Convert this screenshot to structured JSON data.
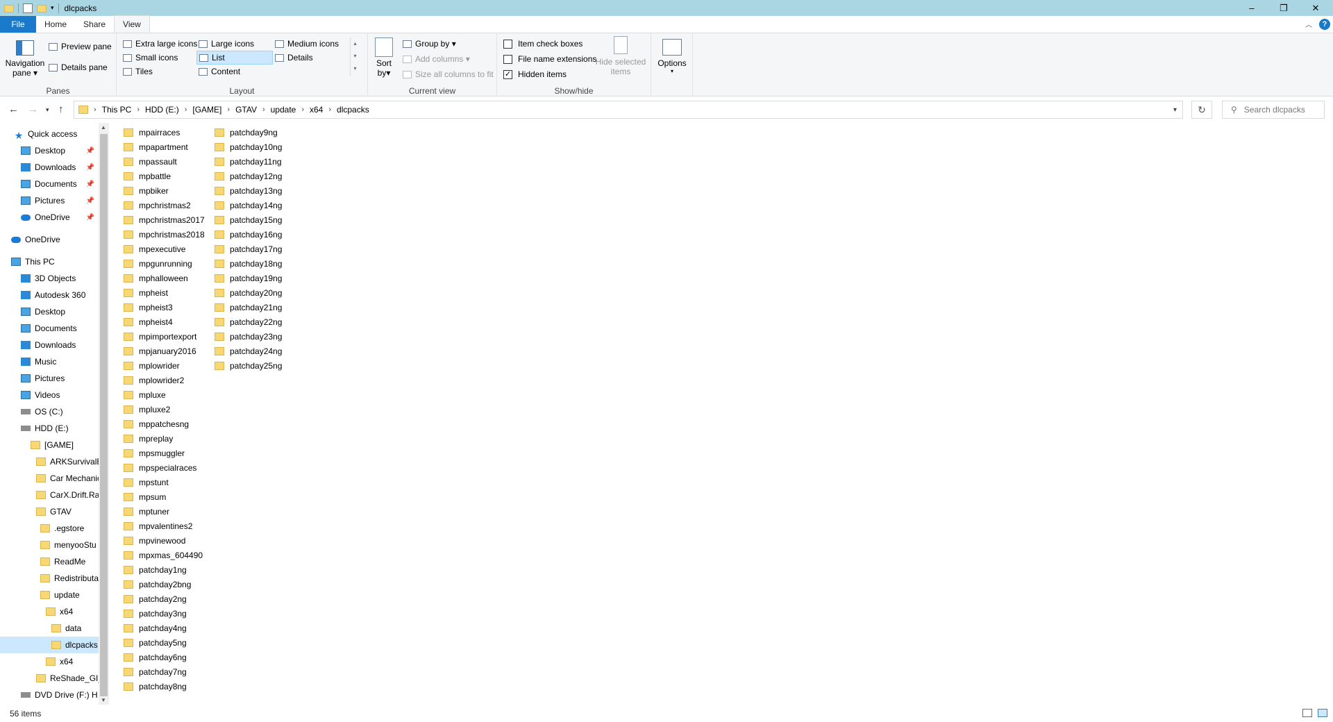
{
  "window": {
    "title": "dlcpacks",
    "minimize": "–",
    "maximize": "❐",
    "close": "✕"
  },
  "ribbon_tabs": [
    "File",
    "Home",
    "Share",
    "View"
  ],
  "ribbon": {
    "panes": {
      "label": "Panes",
      "navigation_pane": "Navigation",
      "navigation_pane_2": "pane",
      "preview_pane": "Preview pane",
      "details_pane": "Details pane"
    },
    "layout": {
      "label": "Layout",
      "options": [
        "Extra large icons",
        "Large icons",
        "Medium icons",
        "Small icons",
        "List",
        "Details",
        "Tiles",
        "Content"
      ],
      "selected": "List"
    },
    "current_view": {
      "label": "Current view",
      "sort_by": "Sort",
      "sort_by_2": "by",
      "group_by": "Group by",
      "add_columns": "Add columns",
      "size_columns": "Size all columns to fit"
    },
    "show_hide": {
      "label": "Show/hide",
      "item_check_boxes": "Item check boxes",
      "file_name_extensions": "File name extensions",
      "hidden_items": "Hidden items",
      "hide_selected": "Hide selected",
      "hide_selected_2": "items"
    },
    "options": "Options"
  },
  "address": {
    "crumbs": [
      "This PC",
      "HDD (E:)",
      "[GAME]",
      "GTAV",
      "update",
      "x64",
      "dlcpacks"
    ],
    "search_placeholder": "Search dlcpacks"
  },
  "nav": [
    {
      "label": "Quick access",
      "icon": "star-icon"
    },
    {
      "label": "Desktop",
      "icon": "desktop-icon",
      "pinned": true
    },
    {
      "label": "Downloads",
      "icon": "download-icon",
      "pinned": true
    },
    {
      "label": "Documents",
      "icon": "documents-icon",
      "pinned": true
    },
    {
      "label": "Pictures",
      "icon": "pictures-icon",
      "pinned": true
    },
    {
      "label": "OneDrive",
      "icon": "cloud-icon",
      "pinned": true
    },
    {
      "label": "OneDrive",
      "icon": "cloud-icon"
    },
    {
      "label": "This PC",
      "icon": "pc-icon"
    },
    {
      "label": "3D Objects",
      "icon": "3d-objects-icon"
    },
    {
      "label": "Autodesk 360",
      "icon": "autodesk-icon"
    },
    {
      "label": "Desktop",
      "icon": "desktop-icon"
    },
    {
      "label": "Documents",
      "icon": "documents-icon"
    },
    {
      "label": "Downloads",
      "icon": "download-icon"
    },
    {
      "label": "Music",
      "icon": "music-icon"
    },
    {
      "label": "Pictures",
      "icon": "pictures-icon"
    },
    {
      "label": "Videos",
      "icon": "videos-icon"
    },
    {
      "label": "OS (C:)",
      "icon": "drive-icon"
    },
    {
      "label": "HDD (E:)",
      "icon": "drive-icon"
    },
    {
      "label": "[GAME]",
      "icon": "folder-icon"
    },
    {
      "label": "ARKSurvivalE",
      "icon": "folder-icon"
    },
    {
      "label": "Car Mechanic",
      "icon": "folder-icon"
    },
    {
      "label": "CarX.Drift.Rac",
      "icon": "folder-icon"
    },
    {
      "label": "GTAV",
      "icon": "folder-icon"
    },
    {
      "label": ".egstore",
      "icon": "folder-icon"
    },
    {
      "label": "menyooStu",
      "icon": "folder-icon"
    },
    {
      "label": "ReadMe",
      "icon": "folder-icon"
    },
    {
      "label": "Redistributa",
      "icon": "folder-icon"
    },
    {
      "label": "update",
      "icon": "folder-icon"
    },
    {
      "label": "x64",
      "icon": "folder-icon"
    },
    {
      "label": "data",
      "icon": "folder-icon"
    },
    {
      "label": "dlcpacks",
      "icon": "folder-icon",
      "selected": true
    },
    {
      "label": "x64",
      "icon": "folder-icon"
    },
    {
      "label": "ReShade_GI_E",
      "icon": "folder-icon"
    },
    {
      "label": "DVD Drive (F:) H",
      "icon": "dvd-icon"
    }
  ],
  "files_col1": [
    "mpairraces",
    "mpapartment",
    "mpassault",
    "mpbattle",
    "mpbiker",
    "mpchristmas2",
    "mpchristmas2017",
    "mpchristmas2018",
    "mpexecutive",
    "mpgunrunning",
    "mphalloween",
    "mpheist",
    "mpheist3",
    "mpheist4",
    "mpimportexport",
    "mpjanuary2016",
    "mplowrider",
    "mplowrider2",
    "mpluxe",
    "mpluxe2",
    "mppatchesng",
    "mpreplay",
    "mpsmuggler",
    "mpspecialraces",
    "mpstunt",
    "mpsum",
    "mptuner",
    "mpvalentines2",
    "mpvinewood",
    "mpxmas_604490",
    "patchday1ng",
    "patchday2bng",
    "patchday2ng",
    "patchday3ng",
    "patchday4ng",
    "patchday5ng",
    "patchday6ng",
    "patchday7ng",
    "patchday8ng"
  ],
  "files_col2": [
    "patchday9ng",
    "patchday10ng",
    "patchday11ng",
    "patchday12ng",
    "patchday13ng",
    "patchday14ng",
    "patchday15ng",
    "patchday16ng",
    "patchday17ng",
    "patchday18ng",
    "patchday19ng",
    "patchday20ng",
    "patchday21ng",
    "patchday22ng",
    "patchday23ng",
    "patchday24ng",
    "patchday25ng"
  ],
  "status": {
    "items": "56 items"
  }
}
